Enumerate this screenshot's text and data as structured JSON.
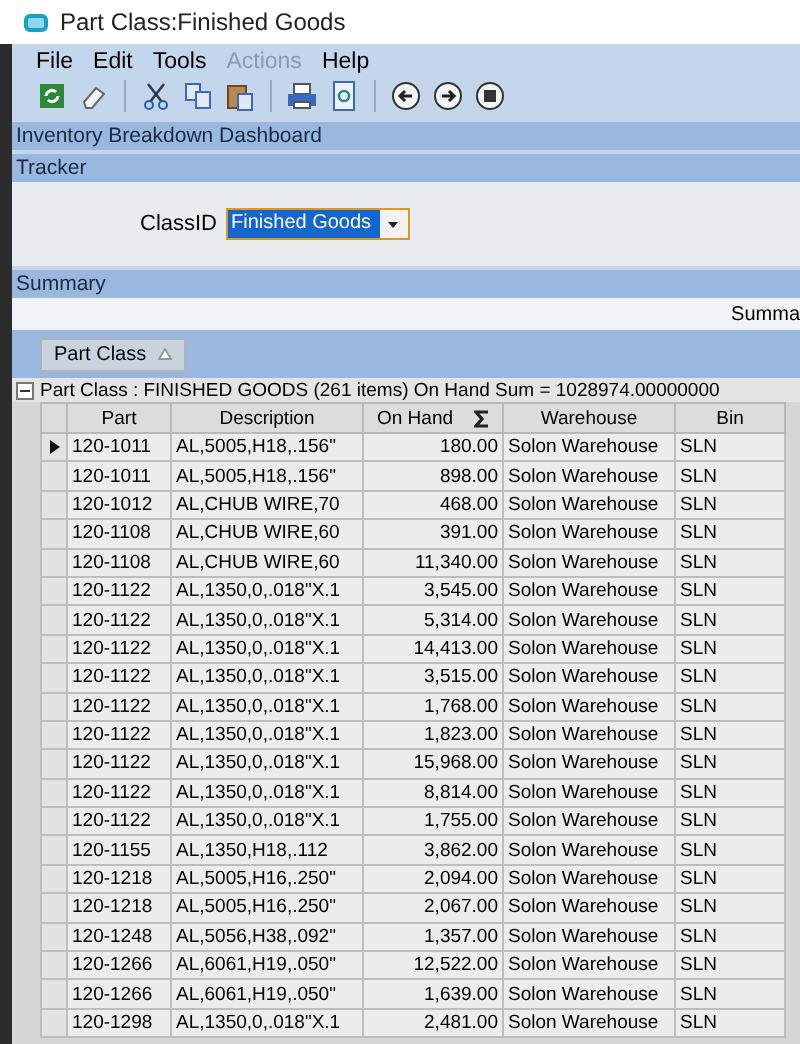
{
  "window": {
    "title": "Part Class:Finished Goods"
  },
  "menu": [
    {
      "label": "File",
      "disabled": false
    },
    {
      "label": "Edit",
      "disabled": false
    },
    {
      "label": "Tools",
      "disabled": false
    },
    {
      "label": "Actions",
      "disabled": true
    },
    {
      "label": "Help",
      "disabled": false
    }
  ],
  "dashboard_title": "Inventory Breakdown Dashboard",
  "tracker": {
    "title": "Tracker",
    "label": "ClassID",
    "value": "Finished Goods"
  },
  "summary": {
    "title": "Summary",
    "caption": "Summa",
    "group_by": "Part Class",
    "group_row": "Part Class : FINISHED GOODS (261 items) On Hand Sum = 1028974.00000000"
  },
  "table": {
    "columns": [
      "Part",
      "Description",
      "On Hand",
      "Warehouse",
      "Bin"
    ],
    "rows": [
      {
        "part": "120-1011",
        "description": "AL,5005,H18,.156\"",
        "on_hand": "180.00",
        "warehouse": "Solon Warehouse",
        "bin": "SLN",
        "selected": true
      },
      {
        "part": "120-1011",
        "description": "AL,5005,H18,.156\"",
        "on_hand": "898.00",
        "warehouse": "Solon Warehouse",
        "bin": "SLN",
        "selected": false
      },
      {
        "part": "120-1012",
        "description": "AL,CHUB WIRE,70",
        "on_hand": "468.00",
        "warehouse": "Solon Warehouse",
        "bin": "SLN",
        "selected": false
      },
      {
        "part": "120-1108",
        "description": "AL,CHUB WIRE,60",
        "on_hand": "391.00",
        "warehouse": "Solon Warehouse",
        "bin": "SLN",
        "selected": false
      },
      {
        "part": "120-1108",
        "description": "AL,CHUB WIRE,60",
        "on_hand": "11,340.00",
        "warehouse": "Solon Warehouse",
        "bin": "SLN",
        "selected": false
      },
      {
        "part": "120-1122",
        "description": "AL,1350,0,.018\"X.1",
        "on_hand": "3,545.00",
        "warehouse": "Solon Warehouse",
        "bin": "SLN",
        "selected": false
      },
      {
        "part": "120-1122",
        "description": "AL,1350,0,.018\"X.1",
        "on_hand": "5,314.00",
        "warehouse": "Solon Warehouse",
        "bin": "SLN",
        "selected": false
      },
      {
        "part": "120-1122",
        "description": "AL,1350,0,.018\"X.1",
        "on_hand": "14,413.00",
        "warehouse": "Solon Warehouse",
        "bin": "SLN",
        "selected": false
      },
      {
        "part": "120-1122",
        "description": "AL,1350,0,.018\"X.1",
        "on_hand": "3,515.00",
        "warehouse": "Solon Warehouse",
        "bin": "SLN",
        "selected": false
      },
      {
        "part": "120-1122",
        "description": "AL,1350,0,.018\"X.1",
        "on_hand": "1,768.00",
        "warehouse": "Solon Warehouse",
        "bin": "SLN",
        "selected": false
      },
      {
        "part": "120-1122",
        "description": "AL,1350,0,.018\"X.1",
        "on_hand": "1,823.00",
        "warehouse": "Solon Warehouse",
        "bin": "SLN",
        "selected": false
      },
      {
        "part": "120-1122",
        "description": "AL,1350,0,.018\"X.1",
        "on_hand": "15,968.00",
        "warehouse": "Solon Warehouse",
        "bin": "SLN",
        "selected": false
      },
      {
        "part": "120-1122",
        "description": "AL,1350,0,.018\"X.1",
        "on_hand": "8,814.00",
        "warehouse": "Solon Warehouse",
        "bin": "SLN",
        "selected": false
      },
      {
        "part": "120-1122",
        "description": "AL,1350,0,.018\"X.1",
        "on_hand": "1,755.00",
        "warehouse": "Solon Warehouse",
        "bin": "SLN",
        "selected": false
      },
      {
        "part": "120-1155",
        "description": "AL,1350,H18,.112",
        "on_hand": "3,862.00",
        "warehouse": "Solon Warehouse",
        "bin": "SLN",
        "selected": false
      },
      {
        "part": "120-1218",
        "description": "AL,5005,H16,.250\"",
        "on_hand": "2,094.00",
        "warehouse": "Solon Warehouse",
        "bin": "SLN",
        "selected": false
      },
      {
        "part": "120-1218",
        "description": "AL,5005,H16,.250\"",
        "on_hand": "2,067.00",
        "warehouse": "Solon Warehouse",
        "bin": "SLN",
        "selected": false
      },
      {
        "part": "120-1248",
        "description": "AL,5056,H38,.092\"",
        "on_hand": "1,357.00",
        "warehouse": "Solon Warehouse",
        "bin": "SLN",
        "selected": false
      },
      {
        "part": "120-1266",
        "description": "AL,6061,H19,.050\"",
        "on_hand": "12,522.00",
        "warehouse": "Solon Warehouse",
        "bin": "SLN",
        "selected": false
      },
      {
        "part": "120-1266",
        "description": "AL,6061,H19,.050\"",
        "on_hand": "1,639.00",
        "warehouse": "Solon Warehouse",
        "bin": "SLN",
        "selected": false
      },
      {
        "part": "120-1298",
        "description": "AL,1350,0,.018\"X.1",
        "on_hand": "2,481.00",
        "warehouse": "Solon Warehouse",
        "bin": "SLN",
        "selected": false
      }
    ]
  }
}
